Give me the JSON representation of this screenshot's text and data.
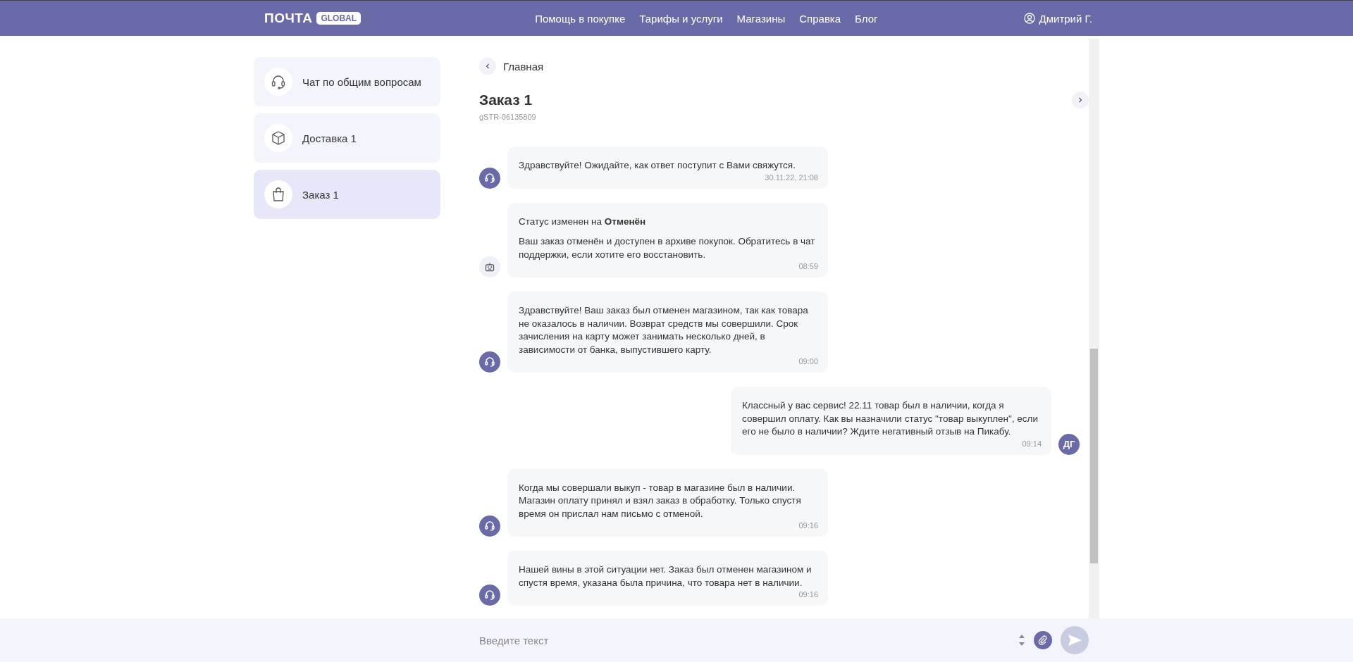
{
  "header": {
    "logo": "ПОЧТА",
    "logo_badge": "GLOBAL",
    "nav": [
      "Помощь в покупке",
      "Тарифы и услуги",
      "Магазины",
      "Справка",
      "Блог"
    ],
    "user": "Дмитрий Г."
  },
  "sidebar": {
    "items": [
      {
        "label": "Чат по общим вопросам",
        "kind": "headset",
        "selected": false
      },
      {
        "label": "Доставка 1",
        "kind": "box",
        "selected": false
      },
      {
        "label": "Заказ 1",
        "kind": "bag",
        "selected": true
      }
    ]
  },
  "chat": {
    "back": "Главная",
    "title": "Заказ 1",
    "order_id": "gSTR-06135809",
    "messages": [
      {
        "kind": "support",
        "lines": [
          "Здравствуйте! Ожидайте, как ответ поступит с Вами свяжутся."
        ],
        "time": "30.11.22, 21:08"
      },
      {
        "kind": "bot",
        "lines": [
          "Статус изменен на **Отменён**",
          "Ваш заказ отменён и доступен в архиве покупок. Обратитесь в чат поддержки, если хотите его восстановить."
        ],
        "time": "08:59"
      },
      {
        "kind": "support",
        "lines": [
          "Здравствуйте! Ваш заказ был отменен магазином, так как товара не оказалось в наличии. Возврат средств мы совершили. Срок зачисления на карту может занимать несколько дней, в зависимости от банка, выпустившего карту."
        ],
        "time": "09:00"
      },
      {
        "kind": "user",
        "initials": "ДГ",
        "lines": [
          "Классный у вас сервис! 22.11 товар был в наличии, когда я совершил оплату. Как вы назначили статус \"товар выкуплен\", если его не было в наличии? Ждите негативный отзыв на Пикабу."
        ],
        "time": "09:14"
      },
      {
        "kind": "support",
        "lines": [
          "Когда мы совершали выкуп - товар в магазине был в наличии. Магазин оплату принял и взял заказ в обработку. Только спустя время он прислал нам письмо с отменой."
        ],
        "time": "09:16"
      },
      {
        "kind": "support",
        "lines": [
          "Нашей вины в этой ситуации нет. Заказ был отменен магазином и спустя время, указана была причина, что товара нет в наличии."
        ],
        "time": "09:16"
      }
    ],
    "input": {
      "placeholder": "Введите текст"
    }
  }
}
